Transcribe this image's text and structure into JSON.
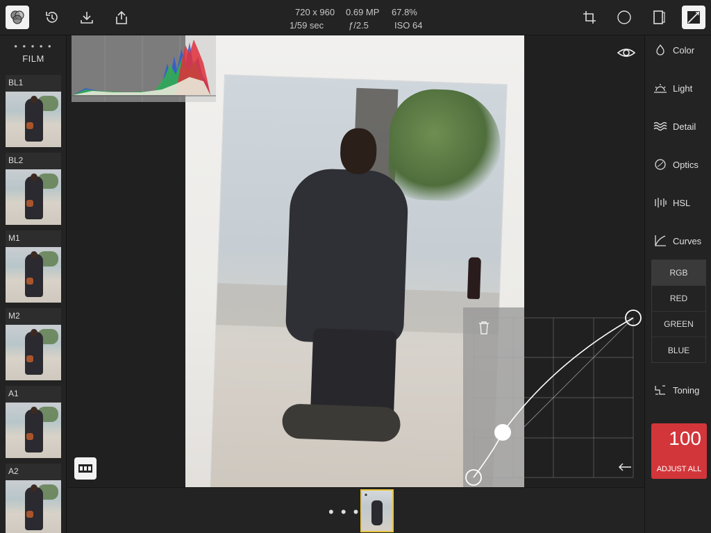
{
  "header": {
    "dimensions": "720 x 960",
    "megapixels": "0.69 MP",
    "zoom": "67.8%",
    "shutter": "1/59 sec",
    "aperture": "ƒ/2.5",
    "iso": "ISO 64"
  },
  "toolbar": {
    "left_icons": [
      "filters-icon",
      "history-icon",
      "download-icon",
      "share-icon"
    ],
    "right_icons": [
      "crop-icon",
      "vignette-icon",
      "straighten-icon",
      "compare-icon"
    ]
  },
  "film_panel": {
    "pager": "• • • • •",
    "title": "FILM",
    "presets": [
      {
        "label": "BL1"
      },
      {
        "label": "BL2"
      },
      {
        "label": "M1"
      },
      {
        "label": "M2"
      },
      {
        "label": "A1"
      },
      {
        "label": "A2"
      }
    ]
  },
  "tools": {
    "items": [
      {
        "label": "Color",
        "icon": "color-drop-icon"
      },
      {
        "label": "Light",
        "icon": "light-sun-icon"
      },
      {
        "label": "Detail",
        "icon": "detail-waves-icon"
      },
      {
        "label": "Optics",
        "icon": "optics-lens-icon"
      },
      {
        "label": "HSL",
        "icon": "hsl-bars-icon"
      },
      {
        "label": "Curves",
        "icon": "curves-icon"
      },
      {
        "label": "Toning",
        "icon": "toning-icon"
      }
    ],
    "channels": [
      "RGB",
      "RED",
      "GREEN",
      "BLUE"
    ],
    "selected_channel": "RGB"
  },
  "adjust_all": {
    "value": "100",
    "label": "ADJUST ALL",
    "color": "#d2363a"
  },
  "bottom": {
    "more": "• • •"
  },
  "colors": {
    "accent_selected_thumb": "#e8c540",
    "panel_bg": "#232323"
  }
}
